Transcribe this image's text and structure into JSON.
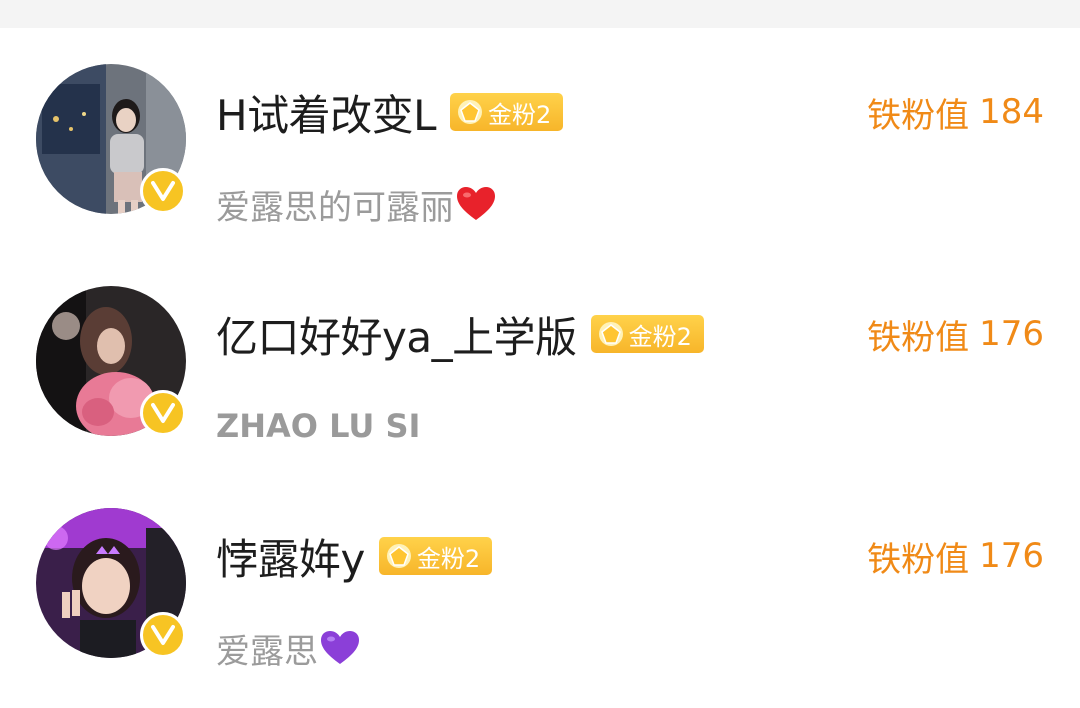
{
  "fans": [
    {
      "name": "H试着改变L",
      "badge": "金粉2",
      "description": "爱露思的可露丽",
      "emoji": "red-heart",
      "emoji_color": "#e8222b",
      "iron_fan_label": "铁粉值",
      "iron_fan_value": "184"
    },
    {
      "name": "亿口好好ya_上学版",
      "badge": "金粉2",
      "description": "ZHAO LU SI",
      "emoji": "",
      "iron_fan_label": "铁粉值",
      "iron_fan_value": "176"
    },
    {
      "name": "悖露姩y",
      "badge": "金粉2",
      "description": "爱露思",
      "emoji": "purple-heart",
      "emoji_color": "#8b3fd8",
      "iron_fan_label": "铁粉值",
      "iron_fan_value": "176"
    }
  ],
  "colors": {
    "accent_orange": "#f08a17",
    "verified_yellow": "#f7c423",
    "gold_badge": "#f7b52a"
  }
}
